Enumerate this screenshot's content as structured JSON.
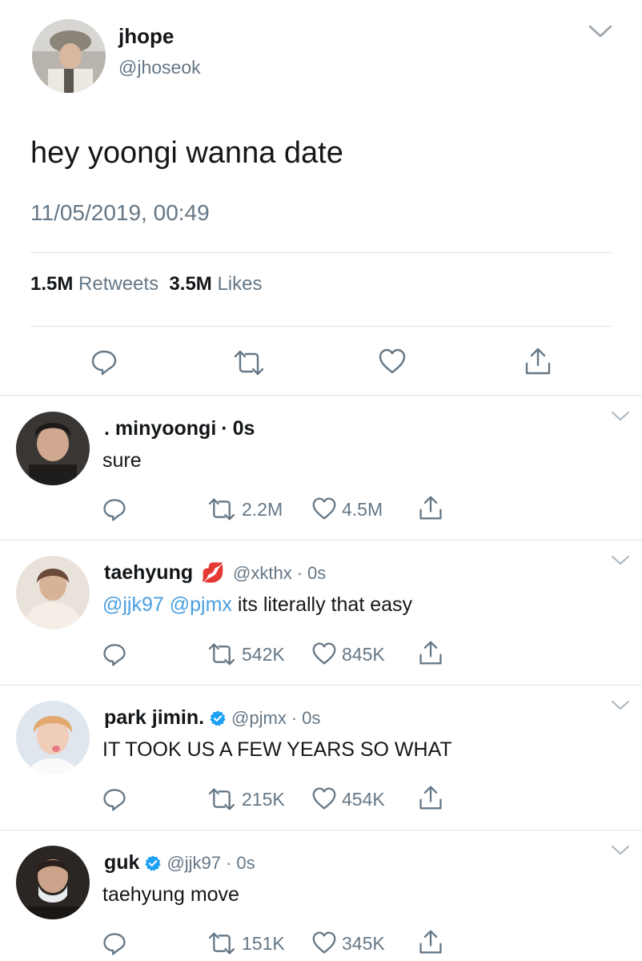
{
  "main_tweet": {
    "name": "jhope",
    "handle": "@jhoseok",
    "text": "hey yoongi wanna date",
    "timestamp": "11/05/2019, 00:49",
    "retweets_count": "1.5M",
    "retweets_label": "Retweets",
    "likes_count": "3.5M",
    "likes_label": "Likes"
  },
  "replies": [
    {
      "name": ". minyoongi",
      "separator": "·",
      "time": "0s",
      "text": "sure",
      "retweets": "2.2M",
      "likes": "4.5M"
    },
    {
      "name": "taehyung",
      "emoji": "💋",
      "handle": "@xkthx",
      "separator": "·",
      "time": "0s",
      "mention1": "@jjk97",
      "mention2": "@pjmx",
      "text": "its literally that easy",
      "retweets": "542K",
      "likes": "845K"
    },
    {
      "name": "park jimin.",
      "verified": true,
      "handle": "@pjmx",
      "separator": "·",
      "time": "0s",
      "text": "IT TOOK US A FEW YEARS SO WHAT",
      "retweets": "215K",
      "likes": "454K"
    },
    {
      "name": "guk",
      "verified": true,
      "handle": "@jjk97",
      "separator": "·",
      "time": "0s",
      "text": "taehyung move",
      "retweets": "151K",
      "likes": "345K"
    }
  ],
  "colors": {
    "text": "#14171a",
    "secondary": "#657786",
    "link": "#4a9fe0",
    "verified": "#1da1f2",
    "divider": "#dfe3e6"
  }
}
